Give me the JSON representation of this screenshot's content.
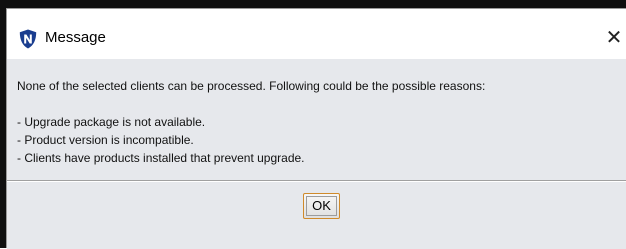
{
  "dialog": {
    "title": "Message",
    "icon": "shield-n-logo-icon",
    "close_glyph": "✕",
    "message_lines": [
      "None of the selected clients can be processed. Following could be the possible reasons:",
      "- Upgrade package is not available.",
      "- Product version is incompatible.",
      "- Clients have products installed that prevent upgrade."
    ],
    "ok_label": "OK"
  },
  "colors": {
    "brand_icon": "#1a3d8f",
    "content_background": "#e6e8ec",
    "ok_border_accent": "#d08a2a"
  }
}
